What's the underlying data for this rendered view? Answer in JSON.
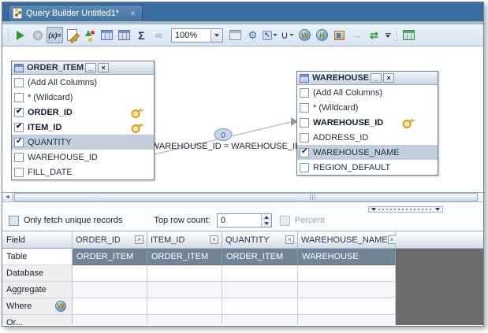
{
  "tab": {
    "title": "Query Builder Untitled1*",
    "close_glyph": "×"
  },
  "toolbar": {
    "zoom_value": "100%",
    "icon_names": [
      "toolbar-grip",
      "execute",
      "stop",
      "function-variables",
      "edit-sql",
      "auto-layout",
      "add-table",
      "table-data",
      "aggregates",
      "joins",
      "zoom-combo",
      "form-view",
      "tools",
      "select-mode",
      "union",
      "where-clause",
      "having-clause",
      "package",
      "forward",
      "generate-sql",
      "overflow",
      "toolbar-grip-2",
      "export-results"
    ],
    "glyphs": {
      "fx": "(x)=",
      "sigma": "Σ",
      "joins": "∞",
      "tools": "⚙",
      "select": "↖",
      "union": "∪",
      "where": "W",
      "having": "H",
      "forward": "→",
      "generate": "⇄"
    }
  },
  "diagram": {
    "tables": [
      {
        "name": "ORDER_ITEM",
        "controls": {
          "minimize": "_",
          "close": "×"
        },
        "columns": [
          {
            "label": "(Add All Columns)",
            "checked": false
          },
          {
            "label": "* (Wildcard)",
            "checked": false
          },
          {
            "label": "ORDER_ID",
            "checked": true,
            "bold": true,
            "key": true
          },
          {
            "label": "ITEM_ID",
            "checked": true,
            "bold": true,
            "key": true
          },
          {
            "label": "QUANTITY",
            "checked": true,
            "selected": true
          },
          {
            "label": "WAREHOUSE_ID",
            "checked": false
          },
          {
            "label": "FILL_DATE",
            "checked": false
          }
        ]
      },
      {
        "name": "WAREHOUSE",
        "controls": {
          "minimize": "_",
          "close": "×"
        },
        "columns": [
          {
            "label": "(Add All Columns)",
            "checked": false
          },
          {
            "label": "* (Wildcard)",
            "checked": false
          },
          {
            "label": "WAREHOUSE_ID",
            "checked": false,
            "bold": true,
            "key": true
          },
          {
            "label": "ADDRESS_ID",
            "checked": false
          },
          {
            "label": "WAREHOUSE_NAME",
            "checked": true,
            "selected": true
          },
          {
            "label": "REGION_DEFAULT",
            "checked": false
          }
        ]
      }
    ],
    "join": {
      "label": "WAREHOUSE_ID = WAREHOUSE_ID",
      "marker": "0"
    }
  },
  "scrollbar": {
    "left_arrow": "◄"
  },
  "options": {
    "unique_label": "Only fetch unique records",
    "top_row_label": "Top row count:",
    "top_row_value": "0",
    "percent_label": "Percent"
  },
  "grid": {
    "corner_label": "Field",
    "close_glyph": "×",
    "columns": [
      "ORDER_ID",
      "ITEM_ID",
      "QUANTITY",
      "WAREHOUSE_NAME"
    ],
    "rows": [
      {
        "label": "Table",
        "values": [
          "ORDER_ITEM",
          "ORDER_ITEM",
          "ORDER_ITEM",
          "WAREHOUSE"
        ]
      },
      {
        "label": "Database",
        "values": [
          "",
          "",
          "",
          ""
        ]
      },
      {
        "label": "Aggregate",
        "values": [
          "",
          "",
          "",
          ""
        ]
      },
      {
        "label": "Where",
        "values": [
          "",
          "",
          "",
          ""
        ],
        "icon": "where-globe"
      },
      {
        "label": "Or...",
        "values": [
          "",
          "",
          "",
          ""
        ]
      }
    ]
  },
  "colors": {
    "tabbar": "#3A6B9E",
    "tab_active": "#5C89B8",
    "toolbar": "#DCE9F5",
    "slate_cell": "#728497",
    "selection": "#C3CFDC",
    "dead_area": "#6B6B6B",
    "key_gold": "#D8A018"
  }
}
